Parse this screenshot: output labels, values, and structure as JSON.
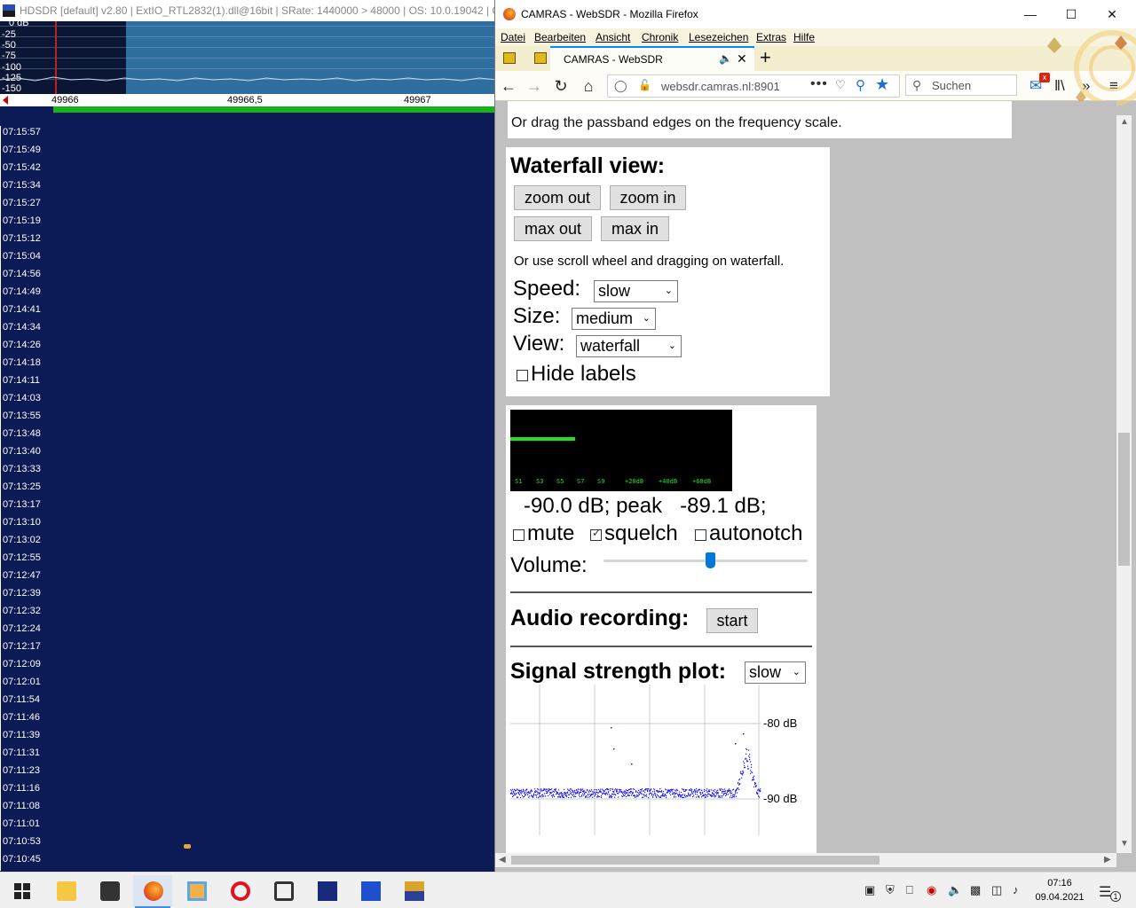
{
  "hdsdr": {
    "title": "HDSDR  [default]  v2.80   |  ExtIO_RTL2832(1).dll@16bit  |  SRate: 1440000 > 48000  |  OS: 10.0.19042  |  C",
    "db_labels": [
      "0 dB",
      "-25",
      "-50",
      "-75",
      "-100",
      "-125",
      "-150"
    ],
    "freq_labels": [
      "49966",
      "49966,5",
      "49967"
    ],
    "timestamps": [
      "07:15:57",
      "07:15:49",
      "07:15:42",
      "07:15:34",
      "07:15:27",
      "07:15:19",
      "07:15:12",
      "07:15:04",
      "07:14:56",
      "07:14:49",
      "07:14:41",
      "07:14:34",
      "07:14:26",
      "07:14:18",
      "07:14:11",
      "07:14:03",
      "07:13:55",
      "07:13:48",
      "07:13:40",
      "07:13:33",
      "07:13:25",
      "07:13:17",
      "07:13:10",
      "07:13:02",
      "07:12:55",
      "07:12:47",
      "07:12:39",
      "07:12:32",
      "07:12:24",
      "07:12:17",
      "07:12:09",
      "07:12:01",
      "07:11:54",
      "07:11:46",
      "07:11:39",
      "07:11:31",
      "07:11:23",
      "07:11:16",
      "07:11:08",
      "07:11:01",
      "07:10:53",
      "07:10:45"
    ]
  },
  "firefox": {
    "window_title": "CAMRAS - WebSDR - Mozilla Firefox",
    "menu": [
      "Datei",
      "Bearbeiten",
      "Ansicht",
      "Chronik",
      "Lesezeichen",
      "Extras",
      "Hilfe"
    ],
    "tab_title": "CAMRAS - WebSDR",
    "url": "websdr.camras.nl:8901",
    "search_placeholder": "Suchen",
    "mail_badge": "x"
  },
  "page": {
    "passband_hint": "Or drag the passband edges on the frequency scale.",
    "waterfall": {
      "heading": "Waterfall view:",
      "zoom_out": "zoom out",
      "zoom_in": "zoom in",
      "max_out": "max out",
      "max_in": "max in",
      "hint": "Or use scroll wheel and dragging on waterfall.",
      "speed_label": "Speed:",
      "speed_value": "slow",
      "size_label": "Size:",
      "size_value": "medium",
      "view_label": "View:",
      "view_value": "waterfall",
      "hide_labels": "Hide labels",
      "hide_labels_checked": false
    },
    "audio": {
      "smeter_scale": [
        "S1",
        "S3",
        "S5",
        "S7",
        "S9",
        "+20dB",
        "+40dB",
        "+60dB"
      ],
      "smeter_level_fraction": 0.29,
      "readout": "-90.0 dB; peak   -89.1 dB;",
      "mute": "mute",
      "mute_checked": false,
      "squelch": "squelch",
      "squelch_checked": true,
      "autonotch": "autonotch",
      "autonotch_checked": false,
      "volume_label": "Volume:",
      "volume_fraction": 0.52,
      "recording_label": "Audio recording:",
      "recording_button": "start",
      "plot_label": "Signal strength plot:",
      "plot_speed": "slow",
      "plot_label_top": "-80 dB",
      "plot_label_bottom": "-90 dB"
    }
  },
  "taskbar": {
    "time": "07:16",
    "date": "09.04.2021",
    "notification_count": "1"
  },
  "colors": {
    "waterfall_bg": "#0c1a55",
    "spectrum_band": "#2f6fa0",
    "freq_bar": "#17b21c",
    "smeter_green": "#1ee31e",
    "plot_blue": "#1a1aff"
  }
}
